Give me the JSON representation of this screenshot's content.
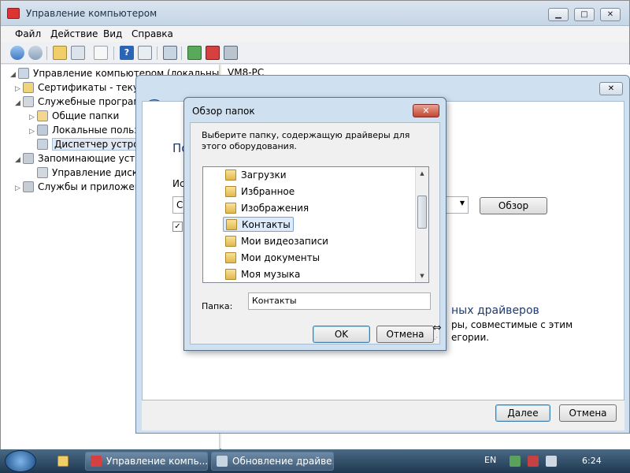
{
  "main_window": {
    "title": "Управление компьютером",
    "menu": [
      "Файл",
      "Действие",
      "Вид",
      "Справка"
    ],
    "tree": [
      {
        "label": "Управление компьютером (локальным)",
        "level": 0,
        "expanded": true
      },
      {
        "label": "Сертификаты - текущ",
        "level": 1,
        "expanded": false
      },
      {
        "label": "Служебные програм",
        "level": 1,
        "expanded": true
      },
      {
        "label": "Общие папки",
        "level": 2,
        "expanded": false
      },
      {
        "label": "Локальные польз",
        "level": 2,
        "expanded": false
      },
      {
        "label": "Диспетчер устрой",
        "level": 2,
        "selected": true
      },
      {
        "label": "Запоминающие устр",
        "level": 1,
        "expanded": true
      },
      {
        "label": "Управление диска",
        "level": 2
      },
      {
        "label": "Службы и приложени",
        "level": 1,
        "expanded": false
      }
    ],
    "right_node": "VM8-PC"
  },
  "wizard": {
    "heading_fragment": "По",
    "label_fragment": "Ис",
    "combo_fragment": "C",
    "browse_button": "Обзор",
    "option_title": "ных драйверов",
    "option_desc_1": "ры, совместимые с этим",
    "option_desc_2": "егории.",
    "next_button": "Далее",
    "cancel_button": "Отмена"
  },
  "browse_dialog": {
    "title": "Обзор папок",
    "close_symbol": "✕",
    "description": "Выберите папку, содержащую драйверы для этого оборудования.",
    "folders": [
      "Загрузки",
      "Избранное",
      "Изображения",
      "Контакты",
      "Мои видеозаписи",
      "Мои документы",
      "Моя музыка"
    ],
    "selected_folder": "Контакты",
    "folder_label": "Папка:",
    "folder_value": "Контакты",
    "ok_button": "OK",
    "cancel_button": "Отмена"
  },
  "taskbar": {
    "tasks": [
      "Управление компь...",
      "Обновление драйве..."
    ],
    "language": "EN",
    "clock": "6:24"
  }
}
